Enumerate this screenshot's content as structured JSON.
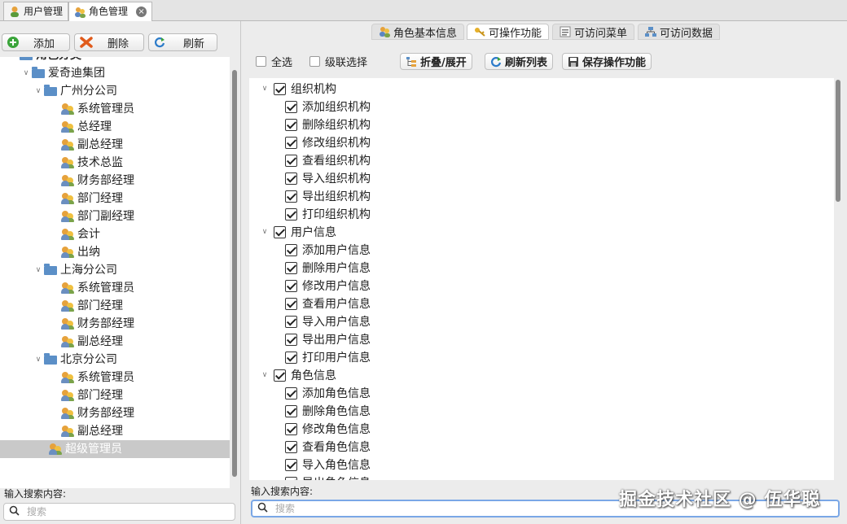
{
  "top_tabs": [
    {
      "label": "用户管理",
      "icon": "user-icon",
      "active": false
    },
    {
      "label": "角色管理",
      "icon": "role-icon",
      "active": true
    }
  ],
  "left_toolbar": {
    "add_label": "添加",
    "delete_label": "删除",
    "refresh_label": "刷新"
  },
  "tree": [
    {
      "label": "角色分类",
      "level": 0,
      "type": "folder",
      "expanded": true
    },
    {
      "label": "爱奇迪集团",
      "level": 1,
      "type": "folder",
      "expanded": true
    },
    {
      "label": "广州分公司",
      "level": 2,
      "type": "folder",
      "expanded": true
    },
    {
      "label": "系统管理员",
      "level": 3,
      "type": "role"
    },
    {
      "label": "总经理",
      "level": 3,
      "type": "role"
    },
    {
      "label": "副总经理",
      "level": 3,
      "type": "role"
    },
    {
      "label": "技术总监",
      "level": 3,
      "type": "role"
    },
    {
      "label": "财务部经理",
      "level": 3,
      "type": "role"
    },
    {
      "label": "部门经理",
      "level": 3,
      "type": "role"
    },
    {
      "label": "部门副经理",
      "level": 3,
      "type": "role"
    },
    {
      "label": "会计",
      "level": 3,
      "type": "role"
    },
    {
      "label": "出纳",
      "level": 3,
      "type": "role"
    },
    {
      "label": "上海分公司",
      "level": 2,
      "type": "folder",
      "expanded": true
    },
    {
      "label": "系统管理员",
      "level": 3,
      "type": "role"
    },
    {
      "label": "部门经理",
      "level": 3,
      "type": "role"
    },
    {
      "label": "财务部经理",
      "level": 3,
      "type": "role"
    },
    {
      "label": "副总经理",
      "level": 3,
      "type": "role"
    },
    {
      "label": "北京分公司",
      "level": 2,
      "type": "folder",
      "expanded": true
    },
    {
      "label": "系统管理员",
      "level": 3,
      "type": "role"
    },
    {
      "label": "部门经理",
      "level": 3,
      "type": "role"
    },
    {
      "label": "财务部经理",
      "level": 3,
      "type": "role"
    },
    {
      "label": "副总经理",
      "level": 3,
      "type": "role"
    },
    {
      "label": "超级管理员",
      "level": 2,
      "type": "role",
      "selected": true
    }
  ],
  "left_search": {
    "label": "输入搜索内容:",
    "placeholder": "搜索"
  },
  "right_tabs": [
    {
      "label": "角色基本信息",
      "icon": "role-icon",
      "active": false
    },
    {
      "label": "可操作功能",
      "icon": "key-icon",
      "active": true
    },
    {
      "label": "可访问菜单",
      "icon": "menu-icon",
      "active": false
    },
    {
      "label": "可访问数据",
      "icon": "data-icon",
      "active": false
    }
  ],
  "right_toolbar": {
    "select_all_label": "全选",
    "cascade_label": "级联选择",
    "collapse_label": "折叠/展开",
    "refresh_list_label": "刷新列表",
    "save_label": "保存操作功能"
  },
  "functions": [
    {
      "label": "组织机构",
      "level": 0,
      "checked": true
    },
    {
      "label": "添加组织机构",
      "level": 1,
      "checked": true
    },
    {
      "label": "删除组织机构",
      "level": 1,
      "checked": true
    },
    {
      "label": "修改组织机构",
      "level": 1,
      "checked": true
    },
    {
      "label": "查看组织机构",
      "level": 1,
      "checked": true
    },
    {
      "label": "导入组织机构",
      "level": 1,
      "checked": true
    },
    {
      "label": "导出组织机构",
      "level": 1,
      "checked": true
    },
    {
      "label": "打印组织机构",
      "level": 1,
      "checked": true
    },
    {
      "label": "用户信息",
      "level": 0,
      "checked": true
    },
    {
      "label": "添加用户信息",
      "level": 1,
      "checked": true
    },
    {
      "label": "删除用户信息",
      "level": 1,
      "checked": true
    },
    {
      "label": "修改用户信息",
      "level": 1,
      "checked": true
    },
    {
      "label": "查看用户信息",
      "level": 1,
      "checked": true
    },
    {
      "label": "导入用户信息",
      "level": 1,
      "checked": true
    },
    {
      "label": "导出用户信息",
      "level": 1,
      "checked": true
    },
    {
      "label": "打印用户信息",
      "level": 1,
      "checked": true
    },
    {
      "label": "角色信息",
      "level": 0,
      "checked": true
    },
    {
      "label": "添加角色信息",
      "level": 1,
      "checked": true
    },
    {
      "label": "删除角色信息",
      "level": 1,
      "checked": true
    },
    {
      "label": "修改角色信息",
      "level": 1,
      "checked": true
    },
    {
      "label": "查看角色信息",
      "level": 1,
      "checked": true
    },
    {
      "label": "导入角色信息",
      "level": 1,
      "checked": true
    },
    {
      "label": "导出角色信息",
      "level": 1,
      "checked": true
    }
  ],
  "right_search": {
    "label": "输入搜索内容:",
    "placeholder": "搜索"
  },
  "watermark": "掘金技术社区 @ 伍华聪"
}
